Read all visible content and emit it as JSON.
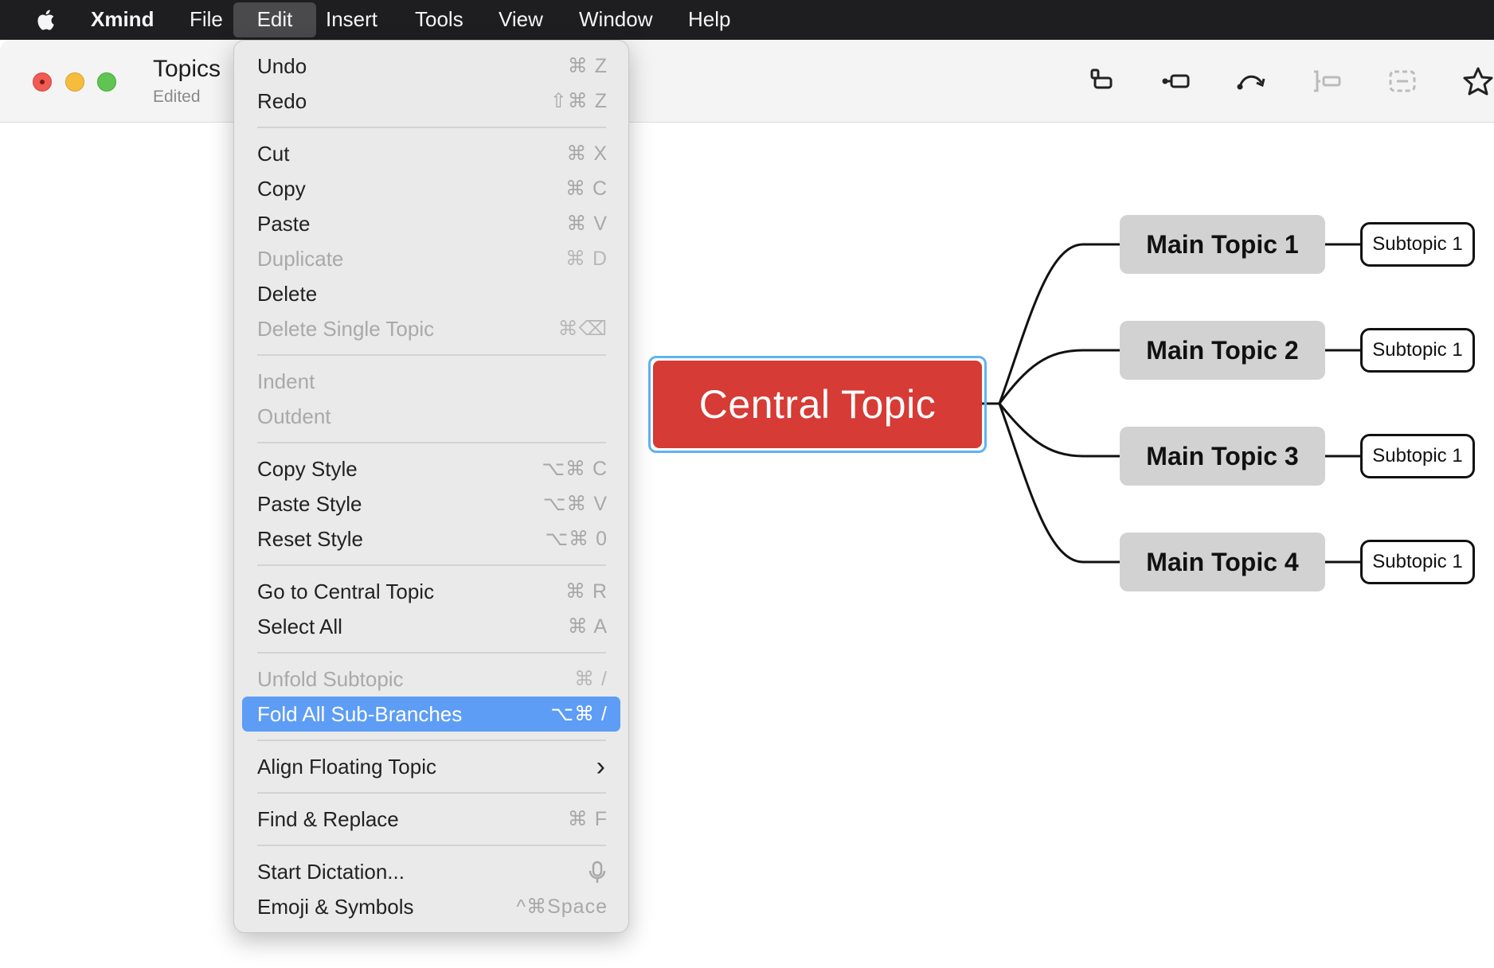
{
  "menubar": {
    "app_name": "Xmind",
    "items": [
      "File",
      "Edit",
      "Insert",
      "Tools",
      "View",
      "Window",
      "Help"
    ],
    "active": "Edit"
  },
  "window": {
    "title": "Topics",
    "subtitle": "Edited"
  },
  "toolbar": {
    "icons": [
      "topic-icon",
      "subtopic-icon",
      "relationship-icon",
      "boundary-icon",
      "summary-icon",
      "marker-icon"
    ]
  },
  "mindmap": {
    "central": "Central Topic",
    "main_topics": [
      "Main Topic 1",
      "Main Topic 2",
      "Main Topic 3",
      "Main Topic 4"
    ],
    "subtopics": [
      "Subtopic 1",
      "Subtopic 1",
      "Subtopic 1",
      "Subtopic 1"
    ],
    "colors": {
      "central": "#d63b35",
      "selection": "#5fb3f0",
      "main_topic": "#d2d2d2"
    }
  },
  "edit_menu": {
    "items": [
      {
        "label": "Undo",
        "shortcut": "⌘ Z"
      },
      {
        "label": "Redo",
        "shortcut": "⇧⌘ Z"
      },
      {
        "label": "Cut",
        "shortcut": "⌘ X"
      },
      {
        "label": "Copy",
        "shortcut": "⌘ C"
      },
      {
        "label": "Paste",
        "shortcut": "⌘ V"
      },
      {
        "label": "Duplicate",
        "shortcut": "⌘ D"
      },
      {
        "label": "Delete",
        "shortcut": ""
      },
      {
        "label": "Delete Single Topic",
        "shortcut": "⌘⌫"
      },
      {
        "label": "Indent",
        "shortcut": ""
      },
      {
        "label": "Outdent",
        "shortcut": ""
      },
      {
        "label": "Copy Style",
        "shortcut": "⌥⌘ C"
      },
      {
        "label": "Paste Style",
        "shortcut": "⌥⌘ V"
      },
      {
        "label": "Reset Style",
        "shortcut": "⌥⌘ 0"
      },
      {
        "label": "Go to Central Topic",
        "shortcut": "⌘ R"
      },
      {
        "label": "Select All",
        "shortcut": "⌘ A"
      },
      {
        "label": "Unfold Subtopic",
        "shortcut": "⌘ /"
      },
      {
        "label": "Fold All Sub-Branches",
        "shortcut": "⌥⌘ /"
      },
      {
        "label": "Align Floating Topic",
        "shortcut": "›"
      },
      {
        "label": "Find & Replace",
        "shortcut": "⌘ F"
      },
      {
        "label": "Start Dictation...",
        "shortcut": ""
      },
      {
        "label": "Emoji & Symbols",
        "shortcut": "^⌘Space"
      }
    ],
    "disabled": [
      "Duplicate",
      "Delete Single Topic",
      "Indent",
      "Outdent",
      "Unfold Subtopic"
    ],
    "highlighted": "Fold All Sub-Branches",
    "highlight_color": "#5e9df5"
  }
}
